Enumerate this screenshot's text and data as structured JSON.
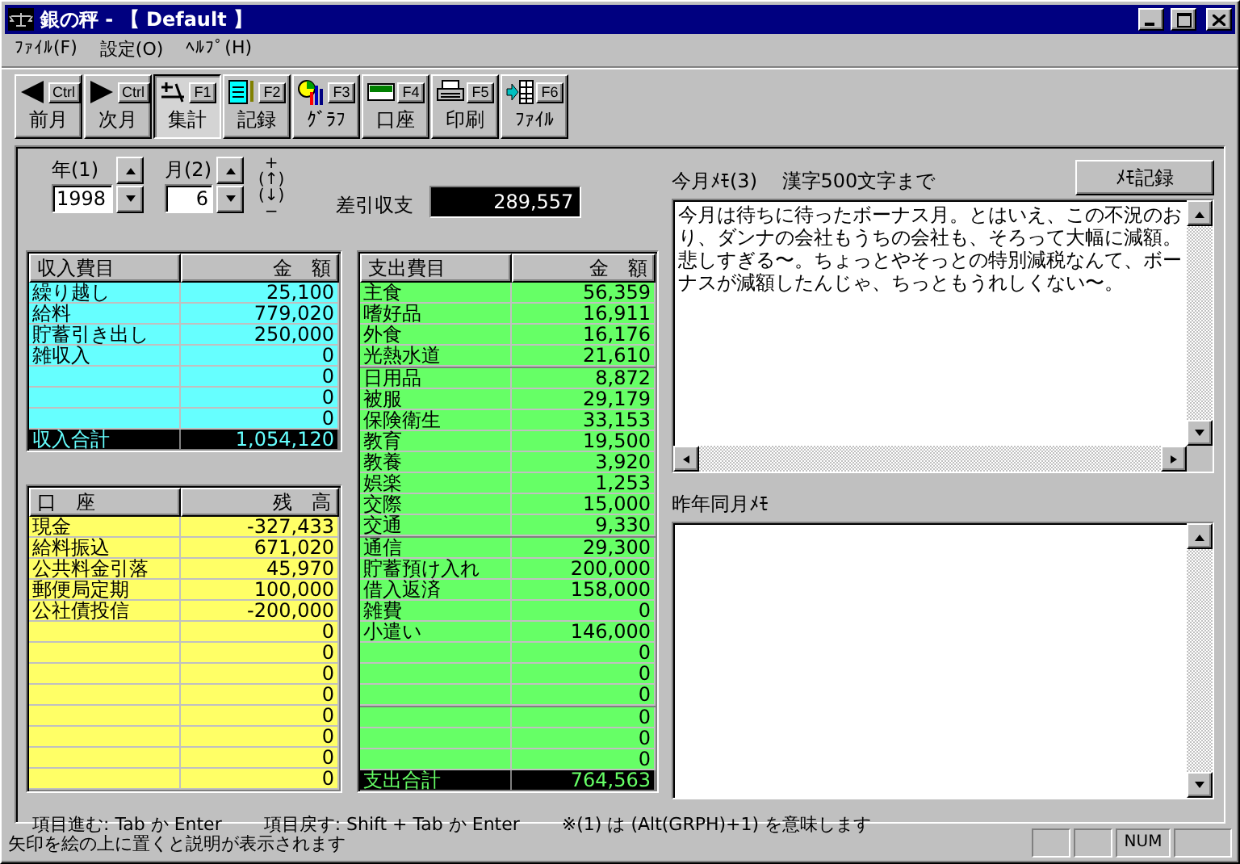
{
  "window": {
    "title": "銀の秤 - 【 Default 】"
  },
  "menu": [
    "ﾌｧｲﾙ(F)",
    "設定(O)",
    "ﾍﾙﾌﾟ(H)"
  ],
  "toolbar": [
    {
      "kind": "prev",
      "key": "Ctrl",
      "label": "前月",
      "selected": false
    },
    {
      "kind": "next",
      "key": "Ctrl",
      "label": "次月",
      "selected": false
    },
    {
      "kind": "summary",
      "key": "F1",
      "label": "集計",
      "selected": true
    },
    {
      "kind": "record",
      "key": "F2",
      "label": "記録",
      "selected": false
    },
    {
      "kind": "graph",
      "key": "F3",
      "label": "ｸﾞﾗﾌ",
      "selected": false
    },
    {
      "kind": "account",
      "key": "F4",
      "label": "口座",
      "selected": false
    },
    {
      "kind": "print",
      "key": "F5",
      "label": "印刷",
      "selected": false
    },
    {
      "kind": "file",
      "key": "F6",
      "label": "ﾌｧｲﾙ",
      "selected": false
    }
  ],
  "period": {
    "year_label": "年(1)",
    "year": "1998",
    "month_label": "月(2)",
    "month": "6",
    "legend": [
      "+",
      "(↑)",
      "(↓)",
      "−"
    ]
  },
  "balance": {
    "label": "差引収支",
    "value": "289,557"
  },
  "income": {
    "columns": [
      "収入費目",
      "金　額"
    ],
    "rows": [
      {
        "name": "繰り越し",
        "amount": "25,100"
      },
      {
        "name": "給料",
        "amount": "779,020"
      },
      {
        "name": "貯蓄引き出し",
        "amount": "250,000"
      },
      {
        "name": "雑収入",
        "amount": "0"
      },
      {
        "amount": "0"
      },
      {
        "amount": "0"
      },
      {
        "amount": "0"
      }
    ],
    "total": {
      "name": "収入合計",
      "amount": "1,054,120"
    }
  },
  "accounts": {
    "columns": [
      "口　座",
      "残　高"
    ],
    "rows": [
      {
        "name": "現金",
        "amount": "-327,433"
      },
      {
        "name": "給料振込",
        "amount": "671,020"
      },
      {
        "name": "公共料金引落",
        "amount": "45,970"
      },
      {
        "name": "郵便局定期",
        "amount": "100,000"
      },
      {
        "name": "公社債投信",
        "amount": "-200,000"
      },
      {
        "amount": "0"
      },
      {
        "amount": "0"
      },
      {
        "amount": "0"
      },
      {
        "amount": "0"
      },
      {
        "amount": "0"
      },
      {
        "amount": "0"
      },
      {
        "amount": "0"
      },
      {
        "amount": "0"
      }
    ]
  },
  "expenses": {
    "columns": [
      "支出費目",
      "金　額"
    ],
    "rows": [
      {
        "name": "主食",
        "amount": "56,359"
      },
      {
        "name": "嗜好品",
        "amount": "16,911"
      },
      {
        "name": "外食",
        "amount": "16,176"
      },
      {
        "name": "光熱水道",
        "amount": "21,610"
      },
      {
        "name": "日用品",
        "amount": "8,872"
      },
      {
        "name": "被服",
        "amount": "29,179"
      },
      {
        "name": "保険衛生",
        "amount": "33,153"
      },
      {
        "name": "教育",
        "amount": "19,500"
      },
      {
        "name": "教養",
        "amount": "3,920"
      },
      {
        "name": "娯楽",
        "amount": "1,253"
      },
      {
        "name": "交際",
        "amount": "15,000"
      },
      {
        "name": "交通",
        "amount": "9,330"
      },
      {
        "name": "通信",
        "amount": "29,300"
      },
      {
        "name": "貯蓄預け入れ",
        "amount": "200,000"
      },
      {
        "name": "借入返済",
        "amount": "158,000"
      },
      {
        "name": "雑費",
        "amount": "0"
      },
      {
        "name": "小遣い",
        "amount": "146,000"
      },
      {
        "amount": "0"
      },
      {
        "amount": "0"
      },
      {
        "amount": "0"
      },
      {
        "amount": "0"
      },
      {
        "amount": "0"
      },
      {
        "amount": "0"
      }
    ],
    "total": {
      "name": "支出合計",
      "amount": "764,563"
    }
  },
  "memo": {
    "label": "今月ﾒﾓ(3)",
    "note": "漢字500文字まで",
    "button": "ﾒﾓ記録",
    "paragraphs": [
      "今月は待ちに待ったボーナス月。とはいえ、この不況のおり、ダンナの会社もうちの会社も、そろって大幅に減額。",
      "悲しすぎる〜。ちょっとやそっとの特別減税なんて、ボーナスが減額したんじゃ、ちっともうれしくない〜。"
    ]
  },
  "last_year_memo": {
    "label": "昨年同月ﾒﾓ"
  },
  "hints": [
    "項目進む: Tab か Enter",
    "項目戻す: Shift + Tab か Enter",
    "※(1) は (Alt(GRPH)+1) を意味します"
  ],
  "status_bar": {
    "message": "矢印を絵の上に置くと説明が表示されます",
    "panes": [
      {
        "kind": "blank"
      },
      {
        "kind": "blank"
      },
      {
        "kind": "text",
        "text": "NUM"
      },
      {
        "kind": "blank"
      }
    ]
  }
}
